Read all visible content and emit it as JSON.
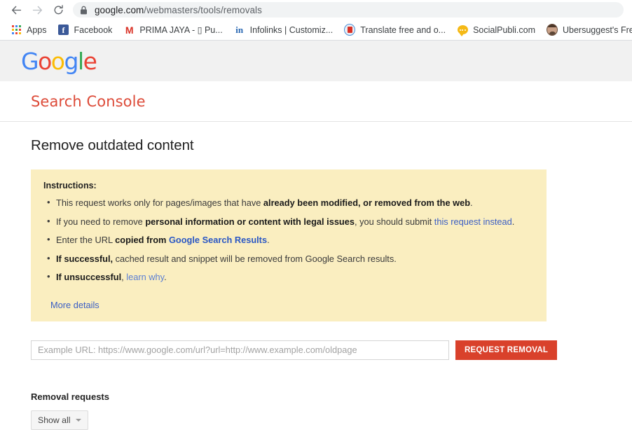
{
  "browser": {
    "back_icon": "back-arrow-icon",
    "forward_icon": "forward-arrow-icon",
    "reload_icon": "reload-icon",
    "lock_icon": "lock-icon",
    "url_host": "google.com",
    "url_path": "/webmasters/tools/removals",
    "bookmarks": [
      {
        "label": "Apps",
        "icon": "apps-grid-icon"
      },
      {
        "label": "Facebook",
        "icon": "facebook-icon"
      },
      {
        "label": "PRIMA JAYA - ▯ Pu...",
        "icon": "gmail-icon"
      },
      {
        "label": "Infolinks | Customiz...",
        "icon": "infolinks-icon"
      },
      {
        "label": "Translate free and o...",
        "icon": "translate-icon"
      },
      {
        "label": "SocialPubli.com",
        "icon": "socialpubli-icon"
      },
      {
        "label": "Ubersuggest's Free...",
        "icon": "ubersuggest-icon"
      }
    ]
  },
  "header": {
    "logo_letters": [
      {
        "char": "G",
        "color": "#4285f4"
      },
      {
        "char": "o",
        "color": "#ea4335"
      },
      {
        "char": "o",
        "color": "#fbbc05"
      },
      {
        "char": "g",
        "color": "#4285f4"
      },
      {
        "char": "l",
        "color": "#34a853"
      },
      {
        "char": "e",
        "color": "#ea4335"
      }
    ],
    "product_name": "Search Console",
    "product_color": "#dd4b39"
  },
  "main": {
    "page_title": "Remove outdated content",
    "instructions": {
      "heading": "Instructions:",
      "background": "#faeec0",
      "bullets": [
        {
          "parts": [
            {
              "text": "This request works only for pages/images that have ",
              "style": "normal"
            },
            {
              "text": "already been modified, or removed from the web",
              "style": "bold"
            },
            {
              "text": ".",
              "style": "normal"
            }
          ]
        },
        {
          "parts": [
            {
              "text": "If you need to remove ",
              "style": "normal"
            },
            {
              "text": "personal information or content with legal issues",
              "style": "bold"
            },
            {
              "text": ", you should submit ",
              "style": "normal"
            },
            {
              "text": "this request instead",
              "style": "link"
            },
            {
              "text": ".",
              "style": "normal"
            }
          ]
        },
        {
          "parts": [
            {
              "text": "Enter the URL ",
              "style": "normal"
            },
            {
              "text": "copied from ",
              "style": "bold"
            },
            {
              "text": "Google Search Results",
              "style": "link-bold"
            },
            {
              "text": ".",
              "style": "normal"
            }
          ]
        },
        {
          "parts": [
            {
              "text": "If successful,",
              "style": "bold"
            },
            {
              "text": " cached result and snippet will be removed from Google Search results.",
              "style": "normal"
            }
          ]
        },
        {
          "parts": [
            {
              "text": "If unsuccessful",
              "style": "bold"
            },
            {
              "text": ", ",
              "style": "normal"
            },
            {
              "text": "learn why",
              "style": "link-light"
            },
            {
              "text": ".",
              "style": "normal"
            }
          ]
        }
      ],
      "more_details_label": "More details"
    },
    "url_field": {
      "value": "",
      "placeholder": "Example URL: https://www.google.com/url?url=http://www.example.com/oldpage"
    },
    "request_button": {
      "label": "REQUEST REMOVAL",
      "color": "#d9412b"
    },
    "removal_requests": {
      "title": "Removal requests",
      "filter_label": "Show all"
    }
  }
}
